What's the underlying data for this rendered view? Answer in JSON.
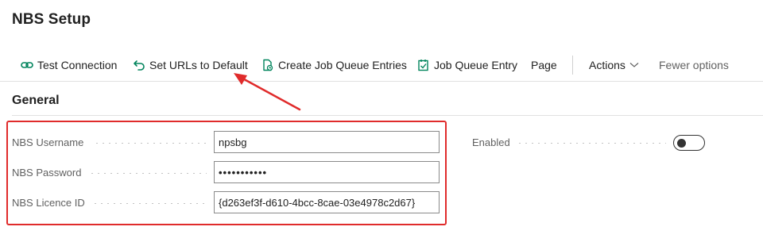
{
  "page": {
    "title": "NBS Setup"
  },
  "actions": [
    {
      "label": "Test Connection",
      "icon": "link-icon"
    },
    {
      "label": "Set URLs to Default",
      "icon": "undo-icon"
    },
    {
      "label": "Create Job Queue Entries",
      "icon": "job-queue-create-icon"
    },
    {
      "label": "Job Queue Entry",
      "icon": "job-queue-entry-icon"
    },
    {
      "label": "Page"
    },
    {
      "label": "Actions",
      "icon": "chevron-down-icon"
    },
    {
      "label": "Fewer options"
    }
  ],
  "general": {
    "title": "General",
    "fields": [
      {
        "label": "NBS Username",
        "value": "npsbg"
      },
      {
        "label": "NBS Password",
        "value": "•••••••••••"
      },
      {
        "label": "NBS Licence ID",
        "value": "{d263ef3f-d610-4bcc-8cae-03e4978c2d67}"
      }
    ],
    "enabled": {
      "label": "Enabled",
      "value": false
    }
  },
  "colors": {
    "highlight": "#e02b2b",
    "accent": "#00845c"
  }
}
